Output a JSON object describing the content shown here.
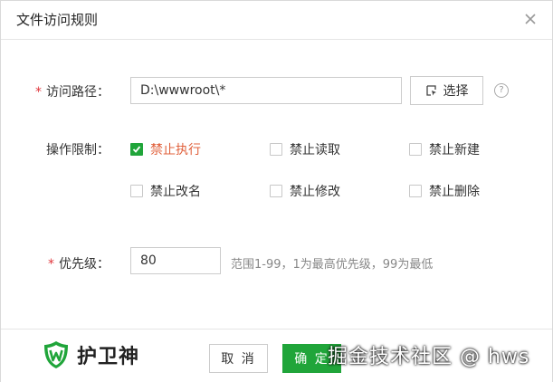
{
  "dialog": {
    "title": "文件访问规则",
    "close_icon": "close-icon"
  },
  "path": {
    "required_mark": "*",
    "label": "访问路径：",
    "value": "D:\\wwwroot\\*",
    "select_label": "选择",
    "select_icon": "folder-select-icon",
    "help_text": "?"
  },
  "restrictions": {
    "label": "操作限制：",
    "options": [
      {
        "label": "禁止执行",
        "checked": true
      },
      {
        "label": "禁止读取",
        "checked": false
      },
      {
        "label": "禁止新建",
        "checked": false
      },
      {
        "label": "禁止改名",
        "checked": false
      },
      {
        "label": "禁止修改",
        "checked": false
      },
      {
        "label": "禁止删除",
        "checked": false
      }
    ]
  },
  "priority": {
    "required_mark": "*",
    "label": "优先级：",
    "value": "80",
    "hint": "范围1-99，1为最高优先级，99为最低"
  },
  "footer": {
    "logo_text": "护卫神",
    "cancel_label": "取 消",
    "ok_label": "确 定"
  },
  "watermark": "掘金技术社区 @ hws",
  "colors": {
    "accent": "#20a53a",
    "required": "#e0353b",
    "active_option": "#e0603b"
  }
}
